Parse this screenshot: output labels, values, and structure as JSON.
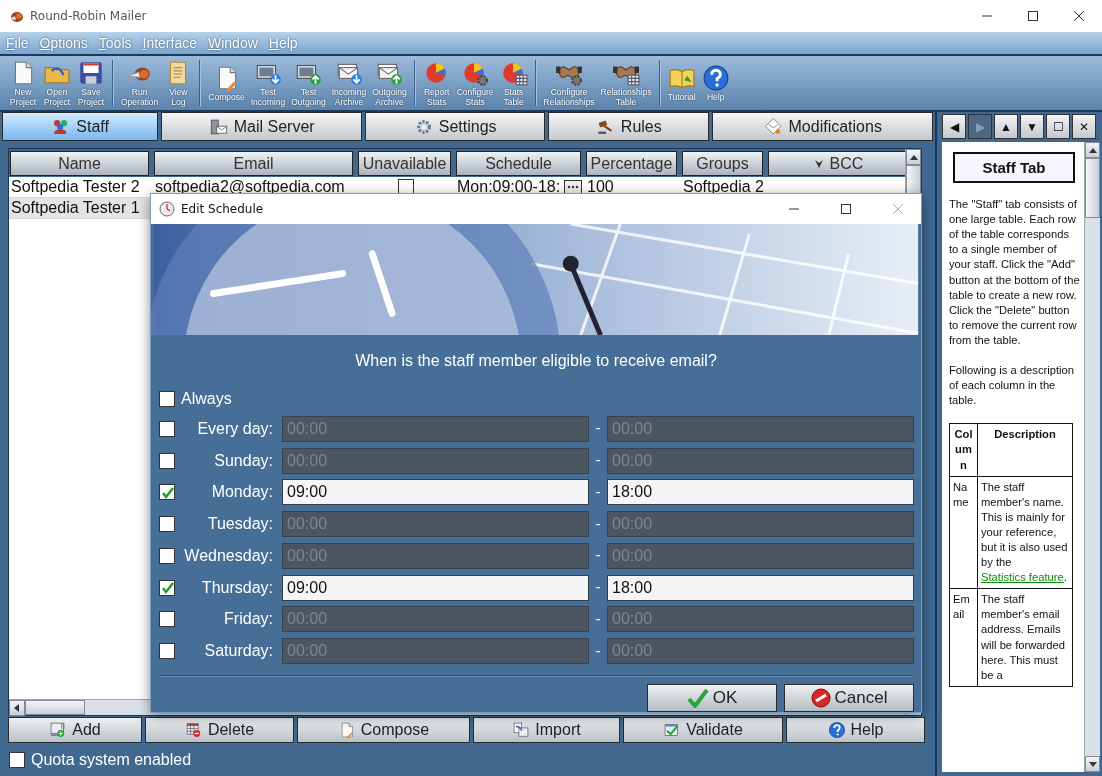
{
  "window": {
    "title": "Round-Robin Mailer"
  },
  "menu": [
    "File",
    "Options",
    "Tools",
    "Interface",
    "Window",
    "Help"
  ],
  "toolbar": [
    [
      "New Project",
      "Open Project",
      "Save Project"
    ],
    [
      "Run Operation",
      "View Log"
    ],
    [
      "Compose",
      "Test Incoming",
      "Test Outgoing",
      "Incoming Archive",
      "Outgoing Archive"
    ],
    [
      "Report Stats",
      "Configure Stats",
      "Stats Table"
    ],
    [
      "Configure Relationships",
      "Relationships Table"
    ],
    [
      "Tutorial",
      "Help"
    ]
  ],
  "tabs": [
    {
      "label": "Staff",
      "selected": true
    },
    {
      "label": "Mail Server",
      "selected": false
    },
    {
      "label": "Settings",
      "selected": false
    },
    {
      "label": "Rules",
      "selected": false
    },
    {
      "label": "Modifications",
      "selected": false
    }
  ],
  "help_nav": [
    {
      "symbol": "◀",
      "disabled": false
    },
    {
      "symbol": "▶",
      "disabled": true
    },
    {
      "symbol": "▲",
      "disabled": false
    },
    {
      "symbol": "▼",
      "disabled": false
    },
    {
      "symbol": "☐",
      "disabled": false
    },
    {
      "symbol": "✕",
      "disabled": false
    }
  ],
  "table": {
    "columns": [
      "Name",
      "Email",
      "Unavailable",
      "Schedule",
      "Percentage",
      "Groups",
      "BCC"
    ],
    "rows": [
      {
        "name": "Softpedia Tester 2",
        "email": "softpedia2@softpedia.com",
        "unavailable": false,
        "schedule": "Mon:09:00-18:",
        "percentage": "100",
        "groups": "Softpedia 2",
        "selected": false
      },
      {
        "name": "Softpedia Tester 1",
        "selected": true
      }
    ]
  },
  "dialog": {
    "title": "Edit Schedule",
    "question": "When is the staff member eligible to receive email?",
    "always": {
      "label": "Always",
      "checked": false
    },
    "days": [
      {
        "label": "Every day:",
        "checked": false,
        "start": "00:00",
        "separator": "-",
        "end": "00:00"
      },
      {
        "label": "Sunday:",
        "checked": false,
        "start": "00:00",
        "separator": "-",
        "end": "00:00"
      },
      {
        "label": "Monday:",
        "checked": true,
        "start": "09:00",
        "separator": "-",
        "end": "18:00"
      },
      {
        "label": "Tuesday:",
        "checked": false,
        "start": "00:00",
        "separator": "-",
        "end": "00:00"
      },
      {
        "label": "Wednesday:",
        "checked": false,
        "start": "00:00",
        "separator": "-",
        "end": "00:00"
      },
      {
        "label": "Thursday:",
        "checked": true,
        "start": "09:00",
        "separator": "-",
        "end": "18:00"
      },
      {
        "label": "Friday:",
        "checked": false,
        "start": "00:00",
        "separator": "-",
        "end": "00:00"
      },
      {
        "label": "Saturday:",
        "checked": false,
        "start": "00:00",
        "separator": "-",
        "end": "00:00"
      }
    ],
    "buttons": [
      {
        "label": "OK",
        "kind": "ok"
      },
      {
        "label": "Cancel",
        "kind": "cancel"
      }
    ]
  },
  "bottom_buttons": [
    "Add",
    "Delete",
    "Compose",
    "Import",
    "Validate",
    "Help"
  ],
  "quota": {
    "label": "Quota system enabled",
    "checked": false
  },
  "help": {
    "title": "Staff Tab",
    "paragraphs": [
      "The \"Staff\" tab consists of one large table. Each row of the table corresponds to a single member of your staff. Click the \"Add\" button at the bottom of the table to create a new row. Click the \"Delete\" button to remove the current row from the table.",
      "Following is a description of each column in the table."
    ],
    "table": {
      "columns": [
        "Column",
        "Description"
      ],
      "rows": [
        {
          "column": "Name",
          "description": "The staff member's name. This is mainly for your reference, but it is also used by the",
          "link": "Statistics feature",
          "after": "."
        },
        {
          "column": "Email",
          "description": "The staff member's email address. Emails will be forwarded here. This must be a"
        }
      ]
    }
  }
}
